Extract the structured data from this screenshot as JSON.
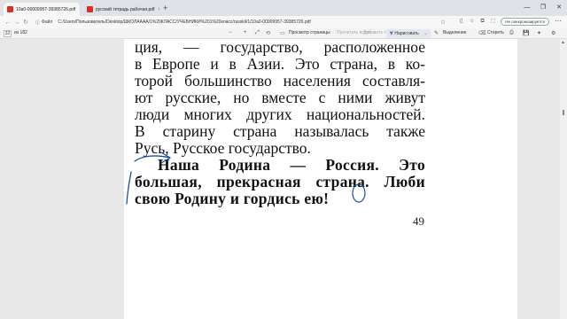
{
  "tabs": [
    {
      "title": "10a0-00009957-39385726.pdf",
      "close": "×"
    },
    {
      "title": "русский тетрадь рабочая.pdf",
      "close": "×"
    }
  ],
  "tab_add": "+",
  "window_buttons": [
    "—",
    "❐",
    "✕"
  ],
  "address": {
    "file_label": "Файл",
    "url": "C:/Users/Пользователь/Desktop/ШКОЛАААА/1%20КЛАСС/УЧЕБНИКИ%201%20класс/russkii/1/10a0-00009957-39385726.pdf",
    "sync_button": "Не синхронизируется"
  },
  "pdf_toolbar": {
    "page_current": "32",
    "page_total": "из 182",
    "zoom_minus": "−",
    "zoom_plus": "+",
    "page_view": "Просмотр страницы",
    "read_aloud": "Прочитать вслух",
    "add_text": "Добавить текст",
    "draw": "Нарисовать",
    "highlight": "Выделение",
    "erase": "Стереть"
  },
  "document": {
    "lines": [
      "ция,  —  государство,  расположенное",
      "в  Европе  и  в  Азии.  Это  страна,  в  ко-",
      "торой  большинство  населения  составля-",
      "ют  русские,  но  вместе  с  ними  живут",
      "люди  многих  других  национальностей.",
      "В  старину  страна  называлась  также",
      "Русь,  Русское  государство."
    ],
    "bold_lines": [
      "Наша  Родина  —  Россия.  Это",
      "большая,  прекрасная  страна.  Люби",
      "свою  Родину  и  гордись  ею!"
    ],
    "page_number": "49"
  },
  "colors": {
    "ink": "#1a4fa0",
    "pdf_icon": "#d93025"
  }
}
